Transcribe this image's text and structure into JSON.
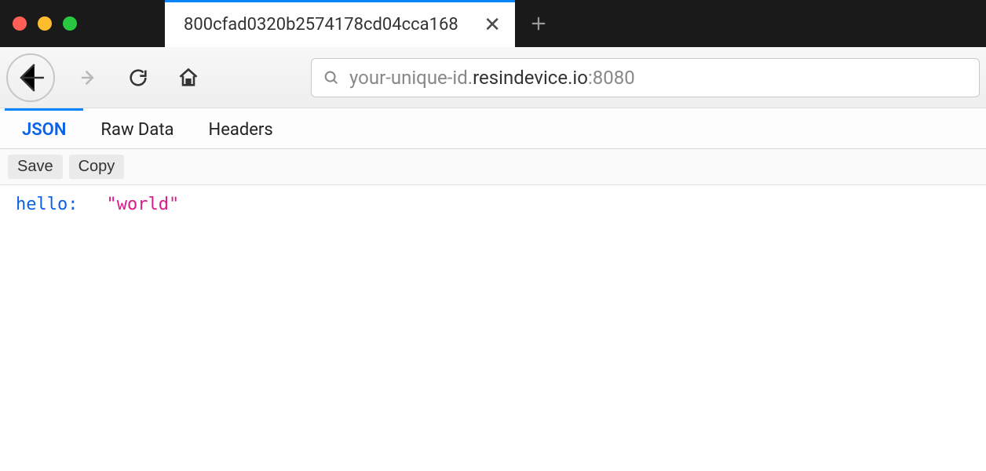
{
  "tab": {
    "title": "800cfad0320b2574178cd04cca168"
  },
  "url": {
    "subdomain": "your-unique-id.",
    "domain": "resindevice.io",
    "port": ":8080"
  },
  "json_viewer": {
    "tabs": {
      "json": "JSON",
      "raw": "Raw Data",
      "headers": "Headers"
    },
    "toolbar": {
      "save": "Save",
      "copy": "Copy"
    },
    "body": {
      "key": "hello:",
      "value": "\"world\""
    }
  }
}
